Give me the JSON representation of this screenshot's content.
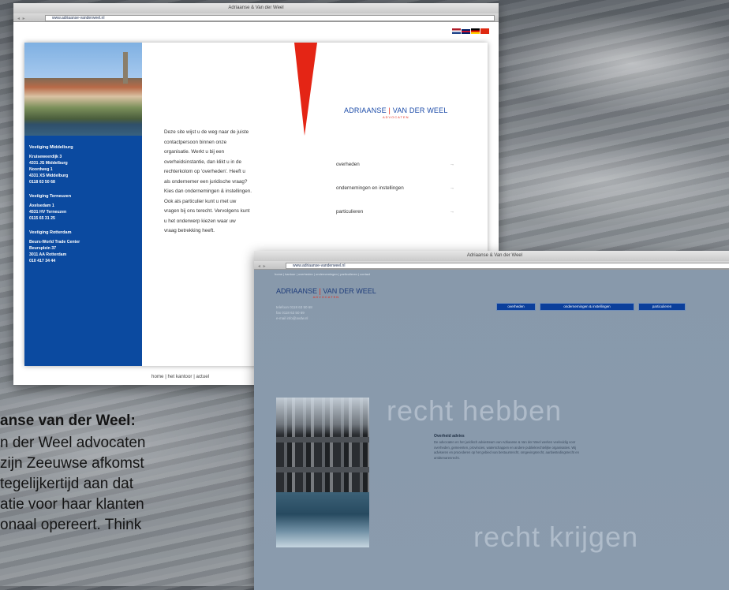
{
  "window1": {
    "title": "Adriaanse & Van der Weel",
    "url": "www.adriaanse-vanderweel.nl",
    "sidebar": [
      {
        "type": "h",
        "text": "Vestiging Middelburg"
      },
      {
        "type": "t",
        "text": "Kruiseweerdijk 3"
      },
      {
        "type": "t",
        "text": "4331 JS Middelburg"
      },
      {
        "type": "t",
        "text": "Noordweg 1"
      },
      {
        "type": "t",
        "text": "4331 XS Middelburg"
      },
      {
        "type": "t",
        "text": "0118 63 50 68"
      },
      {
        "type": "h",
        "text": "Vestiging Terneuzen"
      },
      {
        "type": "t",
        "text": "Axelsedam 1"
      },
      {
        "type": "t",
        "text": "4531 HV Terneuzen"
      },
      {
        "type": "t",
        "text": "0115 65 31 25"
      },
      {
        "type": "h",
        "text": "Vestiging Rotterdam"
      },
      {
        "type": "t",
        "text": "Beurs-World Trade Center"
      },
      {
        "type": "t",
        "text": "Beursplein 37"
      },
      {
        "type": "t",
        "text": "3011 AA Rotterdam"
      },
      {
        "type": "t",
        "text": "010 417 34 44"
      }
    ],
    "intro_lines": [
      "Deze site wijst u de weg naar de juiste",
      "contactpersoon binnen onze",
      "organisatie. Werkt u bij een",
      "overheidsinstantie, dan klikt u in de",
      "rechterkolom op 'overheden'. Heeft u",
      "als ondernemer een juridische vraag?",
      "Kies dan ondernemingen & instellingen.",
      "Ook als particulier kunt u met uw",
      "vragen bij ons terecht. Vervolgens kunt",
      "u het onderwerp kiezen waar uw",
      "vraag betrekking heeft."
    ],
    "logo": {
      "left": "ADRIAANSE",
      "mark": "|",
      "right": "VAN DER WEEL",
      "sub": "ADVOCATEN"
    },
    "menu": [
      {
        "label": "overheden",
        "arrow": "→"
      },
      {
        "label": "ondernemingen en instellingen",
        "arrow": "→"
      },
      {
        "label": "particulieren",
        "arrow": "→"
      }
    ],
    "footer": "home  |  het kantoor  |  actuel"
  },
  "window2": {
    "title": "Adriaanse & Van der Weel",
    "url": "www.adriaanse-vanderweel.nl",
    "nav": "home  |  kantoor  |  overheden  |  ondernemingen  |  particulieren  |  contact",
    "logo": {
      "left": "ADRIAANSE",
      "mark": "|",
      "right": "VAN DER WEEL",
      "sub": "ADVOCATEN"
    },
    "small": [
      "telefoon 0118 63 50 68",
      "fax 0118 63 50 69",
      "e-mail info@avdw.nl"
    ],
    "buttons": [
      "overheden",
      "ondernemingen & instellingen",
      "particulieren"
    ],
    "big_top": "recht hebben",
    "big_bottom": "recht krijgen",
    "heading": "Overheid advies",
    "paragraph": "De advocaten en het juridisch adviesteam van Adriaanse & Van der Weel werken veelvuldig voor overheden, gemeenten, provincies, waterschappen en andere publiekrechtelijke organisaties. Wij adviseren en procederen op het gebied van bestuursrecht, omgevingsrecht, aanbestedingsrecht en ambtenarenrecht."
  },
  "overlay": {
    "heading": "anse van der Weel:",
    "lines": [
      "n der Weel advocaten",
      "zijn Zeeuwse afkomst",
      "tegelijkertijd aan dat",
      "atie voor haar klanten",
      "onaal opereert. Think"
    ]
  },
  "colors": {
    "brand_blue": "#0b4aa0",
    "brand_red": "#e42515",
    "panel_grey": "#8a9bad"
  }
}
